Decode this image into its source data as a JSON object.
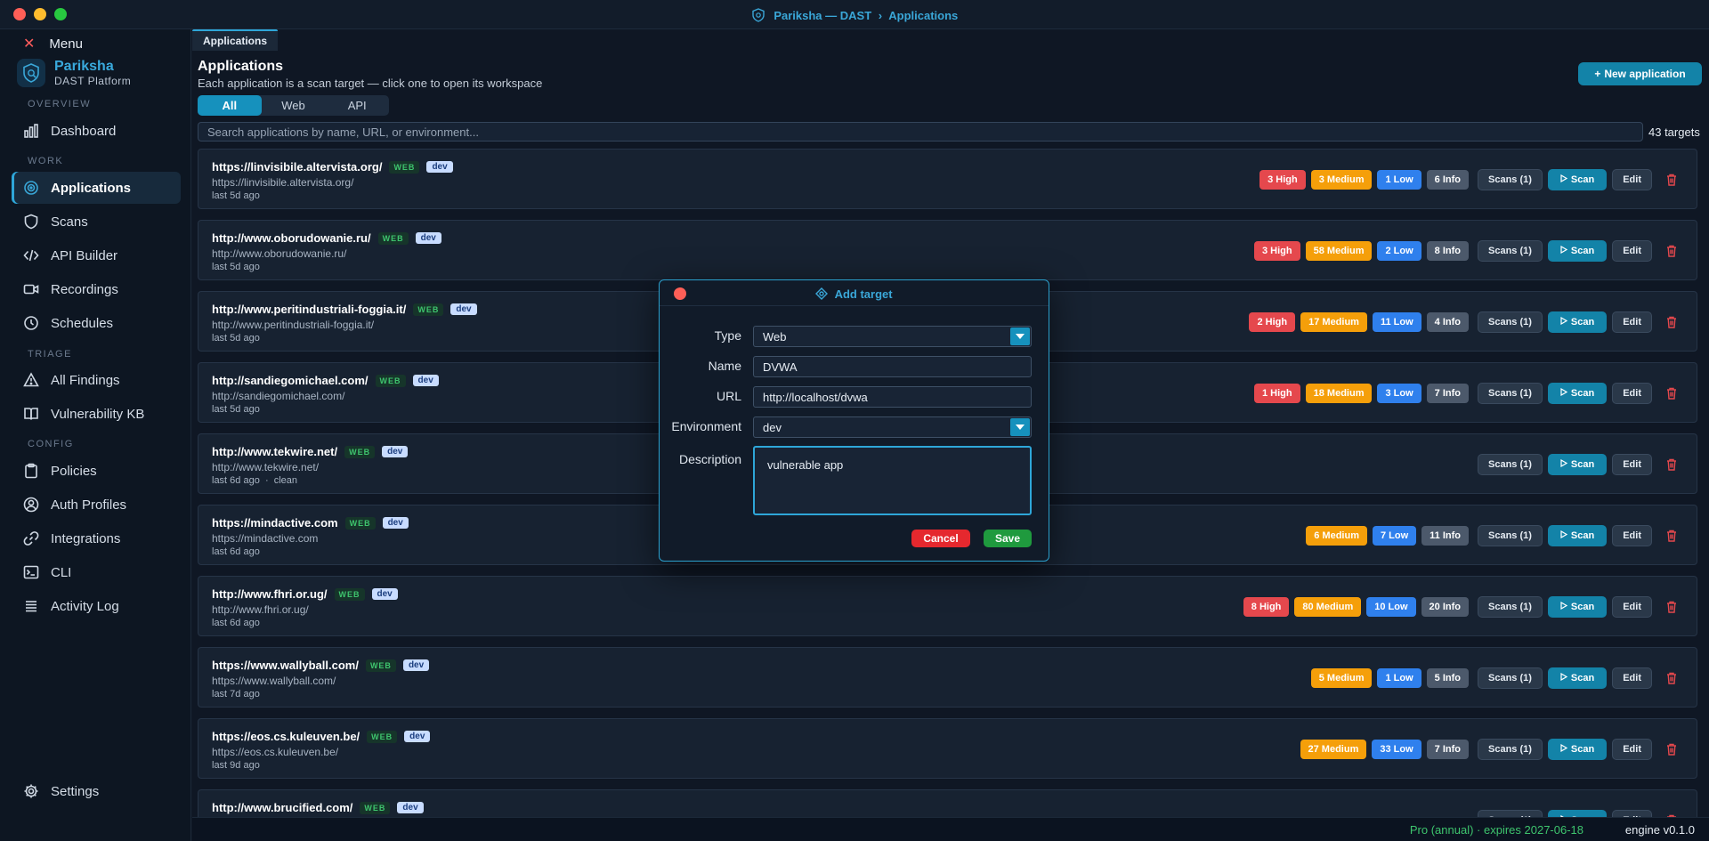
{
  "window": {
    "title_app": "Pariksha — DAST",
    "title_sep": "›",
    "title_page": "Applications",
    "tab": "Applications"
  },
  "sidebar": {
    "menu_label": "Menu",
    "brand_name": "Pariksha",
    "brand_sub": "DAST Platform",
    "sections": {
      "overview": "OVERVIEW",
      "work": "WORK",
      "triage": "TRIAGE",
      "config": "CONFIG"
    },
    "items": [
      {
        "label": "Dashboard",
        "icon": "bar-chart-icon"
      },
      {
        "label": "Applications",
        "icon": "target-icon",
        "active": true
      },
      {
        "label": "Scans",
        "icon": "shield-icon"
      },
      {
        "label": "API Builder",
        "icon": "code-icon"
      },
      {
        "label": "Recordings",
        "icon": "video-icon"
      },
      {
        "label": "Schedules",
        "icon": "clock-icon"
      },
      {
        "label": "All Findings",
        "icon": "warning-icon"
      },
      {
        "label": "Vulnerability KB",
        "icon": "book-icon"
      },
      {
        "label": "Policies",
        "icon": "clipboard-icon"
      },
      {
        "label": "Auth Profiles",
        "icon": "user-icon"
      },
      {
        "label": "Integrations",
        "icon": "link-icon"
      },
      {
        "label": "CLI",
        "icon": "terminal-icon"
      },
      {
        "label": "Activity Log",
        "icon": "list-icon"
      }
    ],
    "settings_label": "Settings"
  },
  "main": {
    "title": "Applications",
    "subtitle": "Each application is a scan target — click one to open its workspace",
    "new_button": "New application",
    "filters": [
      "All",
      "Web",
      "API"
    ],
    "search_placeholder": "Search applications by name, URL, or environment...",
    "target_count": "43 targets",
    "actions": {
      "scans": "Scans (1)",
      "scan": "Scan",
      "edit": "Edit"
    },
    "rows": [
      {
        "name": "https://linvisibile.altervista.org/",
        "type": "WEB",
        "env": "dev",
        "url": "https://linvisibile.altervista.org/",
        "last": "last 5d ago",
        "high": "3 High",
        "medium": "3 Medium",
        "low": "1 Low",
        "info": "6 Info"
      },
      {
        "name": "http://www.oborudowanie.ru/",
        "type": "WEB",
        "env": "dev",
        "url": "http://www.oborudowanie.ru/",
        "last": "last 5d ago",
        "high": "3 High",
        "medium": "58 Medium",
        "low": "2 Low",
        "info": "8 Info"
      },
      {
        "name": "http://www.peritindustriali-foggia.it/",
        "type": "WEB",
        "env": "dev",
        "url": "http://www.peritindustriali-foggia.it/",
        "last": "last 5d ago",
        "high": "2 High",
        "medium": "17 Medium",
        "low": "11 Low",
        "info": "4 Info"
      },
      {
        "name": "http://sandiegomichael.com/",
        "type": "WEB",
        "env": "dev",
        "url": "http://sandiegomichael.com/",
        "last": "last 5d ago",
        "high": "1 High",
        "medium": "18 Medium",
        "low": "3 Low",
        "info": "7 Info"
      },
      {
        "name": "http://www.tekwire.net/",
        "type": "WEB",
        "env": "dev",
        "url": "http://www.tekwire.net/",
        "last": "last 6d ago",
        "clean": "clean"
      },
      {
        "name": "https://mindactive.com",
        "type": "WEB",
        "env": "dev",
        "url": "https://mindactive.com",
        "last": "last 6d ago",
        "medium": "6 Medium",
        "low": "7 Low",
        "info": "11 Info"
      },
      {
        "name": "http://www.fhri.or.ug/",
        "type": "WEB",
        "env": "dev",
        "url": "http://www.fhri.or.ug/",
        "last": "last 6d ago",
        "high": "8 High",
        "medium": "80 Medium",
        "low": "10 Low",
        "info": "20 Info"
      },
      {
        "name": "https://www.wallyball.com/",
        "type": "WEB",
        "env": "dev",
        "url": "https://www.wallyball.com/",
        "last": "last 7d ago",
        "medium": "5 Medium",
        "low": "1 Low",
        "info": "5 Info"
      },
      {
        "name": "https://eos.cs.kuleuven.be/",
        "type": "WEB",
        "env": "dev",
        "url": "https://eos.cs.kuleuven.be/",
        "last": "last 9d ago",
        "medium": "27 Medium",
        "low": "33 Low",
        "info": "7 Info"
      },
      {
        "name": "http://www.brucified.com/",
        "type": "WEB",
        "env": "dev",
        "url": "",
        "last": ""
      }
    ]
  },
  "footer": {
    "license": "Pro (annual) · expires 2027-06-18",
    "engine": "engine v0.1.0"
  },
  "dialog": {
    "title": "Add target",
    "labels": {
      "type": "Type",
      "name": "Name",
      "url": "URL",
      "environment": "Environment",
      "description": "Description"
    },
    "values": {
      "type": "Web",
      "name": "DVWA",
      "url": "http://localhost/dvwa",
      "environment": "dev",
      "description": "vulnerable app"
    },
    "cancel": "Cancel",
    "save": "Save"
  },
  "colors": {
    "accent": "#2ea6d8",
    "high": "#e5484d",
    "medium": "#f59f0a",
    "low": "#2f80ed",
    "info": "#4c596b",
    "license": "#3ec46d"
  }
}
